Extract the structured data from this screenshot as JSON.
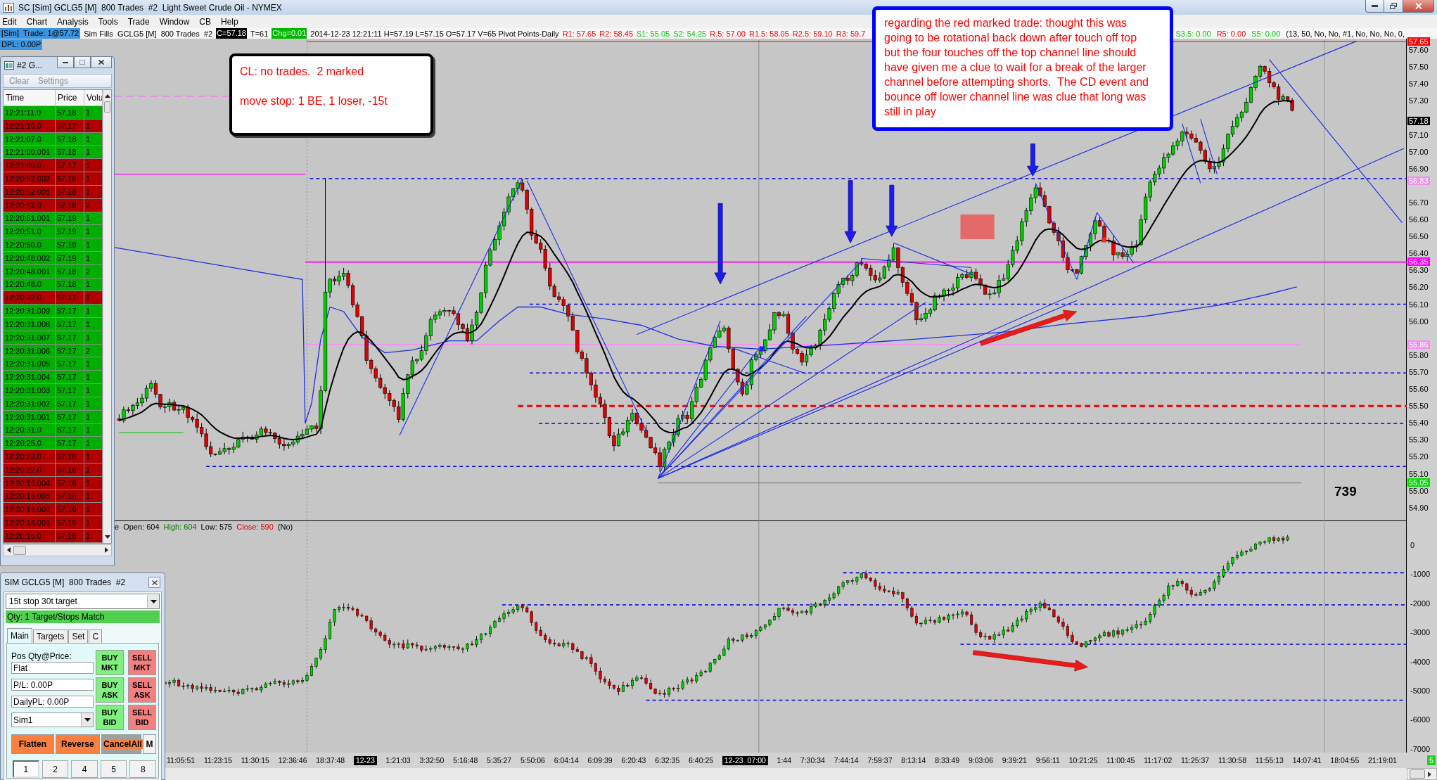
{
  "window": {
    "title": "SC [Sim] GCLG5 [M]  800 Trades  #2  Light Sweet Crude Oil - NYMEX"
  },
  "menu": [
    "Edit",
    "Chart",
    "Analysis",
    "Tools",
    "Trade",
    "Window",
    "CB",
    "Help"
  ],
  "info_bar": {
    "trade": "[Sim]  Trade: 1@57.72",
    "fills": "Sim Fills  GCLG5 [M]  800 Trades  #2",
    "last": "C=57.18",
    "ticks": "T=61",
    "change": "Chg=0.01",
    "stats": "2014-12-23 12:21:11 H=57.19 L=57.15 O=57.17 V=65 Pivot Points-Daily",
    "pivots": [
      {
        "label": "R1: 57.65",
        "kind": "resistance"
      },
      {
        "label": "R2: 58.45",
        "kind": "resistance"
      },
      {
        "label": "S1: 55.05",
        "kind": "support"
      },
      {
        "label": "S2: 54.25",
        "kind": "support"
      },
      {
        "label": "R.5: 57.00",
        "kind": "resistance"
      },
      {
        "label": "R1.5: 58.05",
        "kind": "resistance"
      },
      {
        "label": "R2.5: 59.10",
        "kind": "resistance"
      },
      {
        "label": "R3: 59.7",
        "kind": "resistance"
      }
    ],
    "pivots_after_note": [
      {
        "label": "S3.5: 0.00",
        "kind": "support"
      },
      {
        "label": "R5: 0.00",
        "kind": "resistance"
      },
      {
        "label": "S5: 0.00",
        "kind": "support"
      }
    ],
    "study_inputs": "(13, 50, No, No, #1, No, No, No, 0,",
    "dpl": "DPL: 0.00P"
  },
  "callout": {
    "text": "regarding the red marked trade: thought this was\ngoing to be rotational back down after touch off top\nbut the four touches off the top channel line should\nhave given me a clue to wait for a break of the larger\nchannel before attempting shorts.  The CD event and\nbounce off lower channel line was clue that long was\nstill in play"
  },
  "note": {
    "lines": [
      "CL: no trades.  2 marked",
      "move stop: 1 BE, 1 loser, -15t"
    ]
  },
  "time_and_sales": {
    "title": "#2 G...",
    "menu": [
      "Clear",
      "Settings"
    ],
    "columns": [
      "Time",
      "Price",
      "Volu"
    ],
    "rows": [
      {
        "time": "12:21:11.0",
        "price": "57.18",
        "volume": "1",
        "color": "#00b000"
      },
      {
        "time": "12:21:10.0",
        "price": "57.17",
        "volume": "1",
        "color": "#b00000"
      },
      {
        "time": "12:21:07.0",
        "price": "57.18",
        "volume": "1",
        "color": "#00b000"
      },
      {
        "time": "12:21:00.001",
        "price": "57.18",
        "volume": "1",
        "color": "#00b000"
      },
      {
        "time": "12:21:00.0",
        "price": "57.17",
        "volume": "1",
        "color": "#b00000"
      },
      {
        "time": "12:20:52.002",
        "price": "57.18",
        "volume": "1",
        "color": "#b00000"
      },
      {
        "time": "12:20:52.001",
        "price": "57.18",
        "volume": "1",
        "color": "#b00000"
      },
      {
        "time": "12:20:52.0",
        "price": "57.18",
        "volume": "2",
        "color": "#b00000"
      },
      {
        "time": "12:20:51.001",
        "price": "57.19",
        "volume": "1",
        "color": "#00b000"
      },
      {
        "time": "12:20:51.0",
        "price": "57.19",
        "volume": "1",
        "color": "#00b000"
      },
      {
        "time": "12:20:50.0",
        "price": "57.19",
        "volume": "1",
        "color": "#00b000"
      },
      {
        "time": "12:20:48.002",
        "price": "57.19",
        "volume": "1",
        "color": "#00b000"
      },
      {
        "time": "12:20:48.001",
        "price": "57.18",
        "volume": "2",
        "color": "#00b000"
      },
      {
        "time": "12:20:48.0",
        "price": "57.18",
        "volume": "1",
        "color": "#00b000"
      },
      {
        "time": "12:20:32.0",
        "price": "57.17",
        "volume": "1",
        "color": "#b00000"
      },
      {
        "time": "12:20:31.009",
        "price": "57.17",
        "volume": "1",
        "color": "#00b000"
      },
      {
        "time": "12:20:31.008",
        "price": "57.17",
        "volume": "1",
        "color": "#00b000"
      },
      {
        "time": "12:20:31.007",
        "price": "57.17",
        "volume": "1",
        "color": "#00b000"
      },
      {
        "time": "12:20:31.006",
        "price": "57.17",
        "volume": "2",
        "color": "#00b000"
      },
      {
        "time": "12:20:31.005",
        "price": "57.17",
        "volume": "1",
        "color": "#00b000"
      },
      {
        "time": "12:20:31.004",
        "price": "57.17",
        "volume": "1",
        "color": "#00b000"
      },
      {
        "time": "12:20:31.003",
        "price": "57.17",
        "volume": "1",
        "color": "#00b000"
      },
      {
        "time": "12:20:31.002",
        "price": "57.17",
        "volume": "1",
        "color": "#00b000"
      },
      {
        "time": "12:20:31.001",
        "price": "57.17",
        "volume": "1",
        "color": "#00b000"
      },
      {
        "time": "12:20:31.0",
        "price": "57.17",
        "volume": "1",
        "color": "#00b000"
      },
      {
        "time": "12:20:25.0",
        "price": "57.17",
        "volume": "1",
        "color": "#00b000"
      },
      {
        "time": "12:20:23.0",
        "price": "57.16",
        "volume": "1",
        "color": "#b00000"
      },
      {
        "time": "12:20:22.0",
        "price": "57.16",
        "volume": "1",
        "color": "#b00000"
      },
      {
        "time": "12:20:16.004",
        "price": "57.16",
        "volume": "1",
        "color": "#b00000"
      },
      {
        "time": "12:20:16.003",
        "price": "57.16",
        "volume": "1",
        "color": "#b00000"
      },
      {
        "time": "12:20:16.002",
        "price": "57.16",
        "volume": "1",
        "color": "#b00000"
      },
      {
        "time": "12:20:16.001",
        "price": "57.16",
        "volume": "1",
        "color": "#b00000"
      },
      {
        "time": "12:20:16.0",
        "price": "57.16",
        "volume": "1",
        "color": "#b00000"
      }
    ]
  },
  "price_axis": {
    "markers": [
      {
        "label": "57.65",
        "color": "#ff0000"
      },
      {
        "label": "57.18",
        "color": "#000000"
      },
      {
        "label": "56.83",
        "color": "#ee90ee"
      },
      {
        "label": "56.35",
        "color": "#ff00ff"
      },
      {
        "label": "55.86",
        "color": "#ee90ee"
      },
      {
        "label": "55.05",
        "color": "#00dd00"
      }
    ],
    "labels": [
      "57.60",
      "57.50",
      "57.40",
      "57.30",
      "57.10",
      "57.00",
      "56.90",
      "56.70",
      "56.60",
      "56.50",
      "56.40",
      "56.30",
      "56.20",
      "56.10",
      "56.00",
      "55.80",
      "55.70",
      "55.60",
      "55.50",
      "55.40",
      "55.30",
      "55.20",
      "55.10",
      "55.00",
      "54.90"
    ]
  },
  "chart_counter": "739",
  "lower_panel": {
    "legend": [
      {
        "text": "e",
        "kind": "plain"
      },
      {
        "text": "Open: 604",
        "kind": "plain"
      },
      {
        "text": "High: 604",
        "kind": "high"
      },
      {
        "text": "Low: 575",
        "kind": "plain"
      },
      {
        "text": "Close: 590",
        "kind": "close"
      },
      {
        "text": "(No)",
        "kind": "plain"
      }
    ]
  },
  "lower_axis": {
    "labels": [
      "0",
      "-1000",
      "-2000",
      "-3000",
      "-4000",
      "-5000",
      "-6000",
      "-7000"
    ]
  },
  "order_entry": {
    "title": "SIM GCLG5 [M]  800 Trades  #2",
    "strategy": "15t stop 30t target",
    "status": "Qty: 1 Target/Stops Match",
    "tabs": [
      {
        "label": "Main",
        "selected": true
      },
      {
        "label": "Targets",
        "selected": false
      },
      {
        "label": "Set",
        "selected": false
      },
      {
        "label": "C",
        "selected": false
      }
    ],
    "position_label": "Pos Qty@Price:",
    "position": "Flat",
    "pl": "P/L: 0.00P",
    "daily_pl": "DailyPL: 0.00P",
    "account": "Sim1",
    "order_buttons": [
      {
        "label": "BUY MKT",
        "kind": "buy"
      },
      {
        "label": "SELL MKT",
        "kind": "sell"
      },
      {
        "label": "BUY ASK",
        "kind": "buy"
      },
      {
        "label": "SELL ASK",
        "kind": "sell"
      },
      {
        "label": "BUY BID",
        "kind": "buy"
      },
      {
        "label": "SELL BID",
        "kind": "sell"
      }
    ],
    "action_buttons": [
      {
        "label": "Flatten",
        "kind": "action"
      },
      {
        "label": "Reverse",
        "kind": "action"
      },
      {
        "label": "CancelAll",
        "kind": "focused"
      },
      {
        "label": "M",
        "kind": "plain"
      }
    ],
    "quantity_buttons": [
      {
        "label": "1",
        "selected": true
      },
      {
        "label": "2",
        "selected": false
      },
      {
        "label": "4",
        "selected": false
      },
      {
        "label": "5",
        "selected": false
      },
      {
        "label": "8",
        "selected": false
      }
    ]
  },
  "time_axis": {
    "labels": [
      {
        "label": "11:05:51",
        "kind": "time"
      },
      {
        "label": "11:23:15",
        "kind": "time"
      },
      {
        "label": "11:30:15",
        "kind": "time"
      },
      {
        "label": "12:36:46",
        "kind": "time"
      },
      {
        "label": "18:37:48",
        "kind": "time"
      },
      {
        "label": "12-23",
        "kind": "date"
      },
      {
        "label": "1:21:03",
        "kind": "time"
      },
      {
        "label": "3:32:50",
        "kind": "time"
      },
      {
        "label": "5:16:48",
        "kind": "time"
      },
      {
        "label": "5:35:27",
        "kind": "time"
      },
      {
        "label": "5:50:06",
        "kind": "time"
      },
      {
        "label": "6:04:14",
        "kind": "time"
      },
      {
        "label": "6:09:39",
        "kind": "time"
      },
      {
        "label": "6:20:43",
        "kind": "time"
      },
      {
        "label": "6:32:35",
        "kind": "time"
      },
      {
        "label": "6:40:25",
        "kind": "time"
      },
      {
        "label": "12-23  07:00",
        "kind": "date"
      },
      {
        "label": "1:44",
        "kind": "time"
      },
      {
        "label": "7:30:34",
        "kind": "time"
      },
      {
        "label": "7:44:14",
        "kind": "time"
      },
      {
        "label": "7:59:37",
        "kind": "time"
      },
      {
        "label": "8:13:14",
        "kind": "time"
      },
      {
        "label": "8:33:49",
        "kind": "time"
      },
      {
        "label": "9:03:06",
        "kind": "time"
      },
      {
        "label": "9:39:21",
        "kind": "time"
      },
      {
        "label": "9:56:11",
        "kind": "time"
      },
      {
        "label": "10:21:25",
        "kind": "time"
      },
      {
        "label": "11:00:45",
        "kind": "time"
      },
      {
        "label": "11:17:02",
        "kind": "time"
      },
      {
        "label": "11:25:37",
        "kind": "time"
      },
      {
        "label": "11:30:58",
        "kind": "time"
      },
      {
        "label": "11:55:13",
        "kind": "time"
      },
      {
        "label": "14:07:41",
        "kind": "time"
      },
      {
        "label": "18:04:55",
        "kind": "time"
      },
      {
        "label": "21:19:01",
        "kind": "time"
      }
    ],
    "page": "5"
  }
}
